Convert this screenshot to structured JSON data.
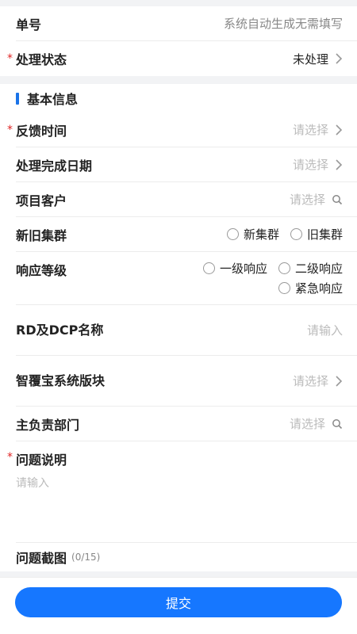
{
  "order": {
    "label": "单号",
    "value": "系统自动生成无需填写"
  },
  "status": {
    "label": "处理状态",
    "value": "未处理",
    "required": "*"
  },
  "section": {
    "title": "基本信息"
  },
  "fields": {
    "feedback_time": {
      "label": "反馈时间",
      "placeholder": "请选择",
      "required": "*"
    },
    "complete_date": {
      "label": "处理完成日期",
      "placeholder": "请选择"
    },
    "customer": {
      "label": "项目客户",
      "placeholder": "请选择"
    },
    "cluster": {
      "label": "新旧集群",
      "options": [
        "新集群",
        "旧集群"
      ]
    },
    "response": {
      "label": "响应等级",
      "options": [
        "一级响应",
        "二级响应",
        "紧急响应"
      ]
    },
    "rd_name": {
      "label": "RD及DCP名称",
      "placeholder": "请输入"
    },
    "module": {
      "label": "智覆宝系统版块",
      "placeholder": "请选择"
    },
    "department": {
      "label": "主负责部门",
      "placeholder": "请选择"
    },
    "issue": {
      "label": "问题说明",
      "placeholder": "请输入",
      "required": "*"
    },
    "screenshots": {
      "label": "问题截图",
      "count": "(0/15)"
    }
  },
  "footer": {
    "submit_label": "提交"
  },
  "colors": {
    "accent": "#1677ff",
    "required": "#e02424"
  },
  "icons": {
    "chevron": "chevron-right-icon",
    "search": "search-icon"
  }
}
